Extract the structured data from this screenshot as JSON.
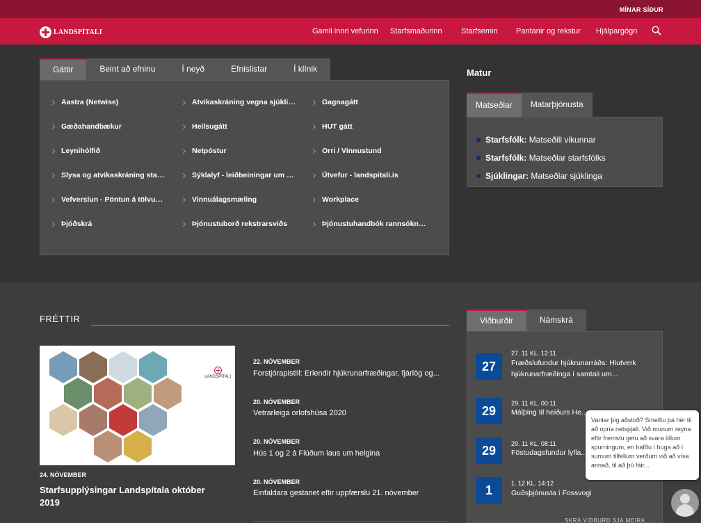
{
  "topbar": {
    "my_pages": "MÍNAR SÍÐUR"
  },
  "header": {
    "logo_text": "LANDSPÍTALI",
    "nav": [
      "Gamli innri vefurinn",
      "Starfsmaðurinn",
      "Starfsemin",
      "Pantanir og rekstur",
      "Hjálpargögn"
    ]
  },
  "gateway": {
    "tabs": [
      "Gáttir",
      "Beint að efninu",
      "Í neyð",
      "Efnislistar",
      "Í klínik"
    ],
    "links": [
      [
        "Aastra (Netwise)",
        "Atvikaskráning vegna sjúklinga",
        "Gagnagátt"
      ],
      [
        "Gæðahandbækur",
        "Heilsugátt",
        "HUT gátt"
      ],
      [
        "Leynihólfið",
        "Netpóstur",
        "Orri / Vinnustund"
      ],
      [
        "Slysa og atvikaskráning starfsmanna",
        "Sýklalyf - leiðbeiningar um notkun",
        "Útvefur - landspitali.is"
      ],
      [
        "Vefverslun - Pöntun á tölvubúnaði",
        "Vinnuálagsmæling",
        "Workplace"
      ],
      [
        "Þjóðskrá",
        "Þjónustuborð rekstrarsviðs",
        "Þjónustuhandbók rannsóknarsviðs"
      ]
    ]
  },
  "food": {
    "title": "Matur",
    "tabs": [
      "Matseðlar",
      "Matarþjónusta"
    ],
    "items": [
      {
        "label": "Starfsfólk:",
        "text": "Matseðill vikunnar"
      },
      {
        "label": "Starfsfólk:",
        "text": "Matseðlar starfsfólks"
      },
      {
        "label": "Sjúklingar:",
        "text": "Matseðlar sjúklinga"
      }
    ]
  },
  "news": {
    "heading": "FRÉTTIR",
    "featured": {
      "date": "24. NÓVEMBER",
      "title": "Starfsupplýsingar Landspítala október 2019",
      "image_logo": "LANDSPÍTALI"
    },
    "items": [
      {
        "date": "22. NÓVEMBER",
        "title": "Forstjórapistill: Erlendir hjúkrunarfræðingar, fjárlög og..."
      },
      {
        "date": "20. NÓVEMBER",
        "title": "Vetrarleiga orlofshúsa 2020"
      },
      {
        "date": "20. NÓVEMBER",
        "title": "Hús 1 og 2 á Flúðum laus um helgina"
      },
      {
        "date": "20. NÓVEMBER",
        "title": "Einfaldara gestanet eftir uppfærslu 21. nóvember"
      }
    ]
  },
  "events": {
    "tabs": [
      "Viðburðir",
      "Námskrá"
    ],
    "items": [
      {
        "day": "27",
        "time": "27. 11 KL. 12:11",
        "title": "Fræðslufundur hjúkrunarráðs: Hlutverk hjúkrunarfræðinga í samtali um..."
      },
      {
        "day": "29",
        "time": "29. 11 KL. 00:11",
        "title": "Málþing til heiðurs He..."
      },
      {
        "day": "29",
        "time": "29. 11 KL. 08:11",
        "title": "Föstudagsfundur lyfla..."
      },
      {
        "day": "1",
        "time": "1. 12 KL. 14:12",
        "title": "Guðsþjónusta í Fossvogi"
      }
    ],
    "footer": "SKRÁ VIÐBURÐ     SJÁ MEIRA"
  },
  "chat": {
    "message": "Vantar þig aðstoð? Smelltu þá hér til að opna netspjall. Við munum reyna eftir fremstu getu að svara öllum spurningum, en hafðu í huga að í sumum tilfellum verðum við að vísa annað, til að þú fáir..."
  },
  "colors": {
    "brand_red": "#c8183f",
    "dark_red": "#8a1431",
    "event_blue": "#0a4a96"
  }
}
